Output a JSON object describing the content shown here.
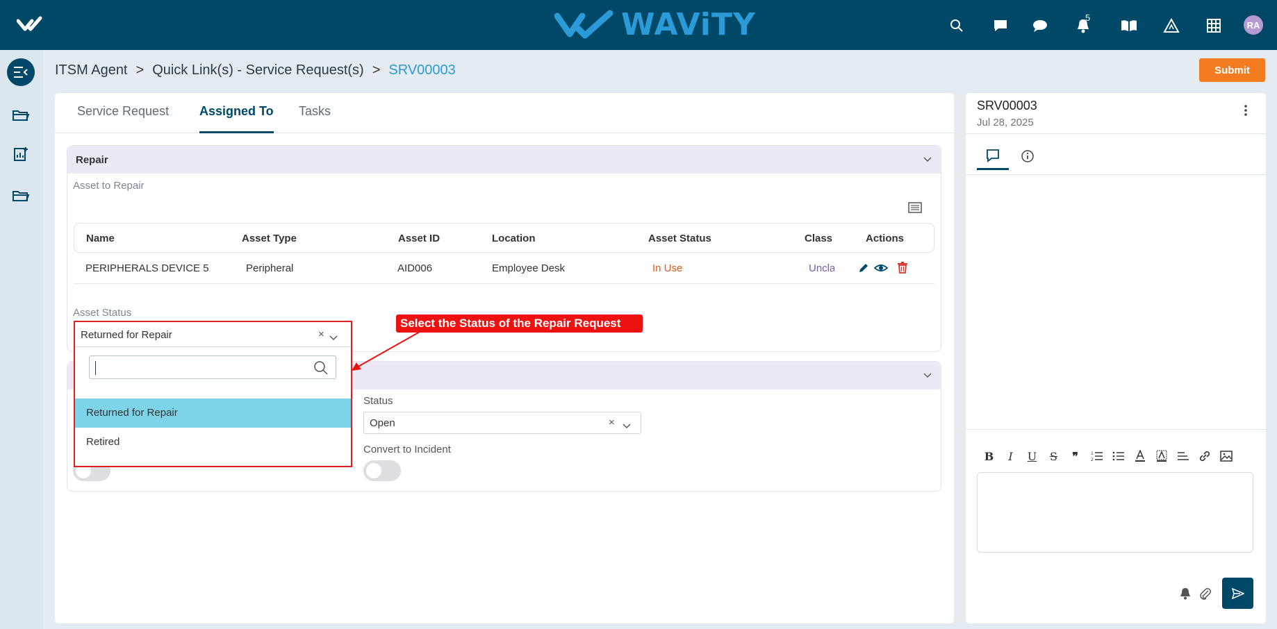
{
  "header": {
    "brand": "WAViTY",
    "notification_count": "5",
    "avatar_initials": "RA",
    "icons": [
      "search-icon",
      "message-square-icon",
      "chat-icon",
      "bell-icon",
      "book-icon",
      "warning-icon",
      "grid-icon"
    ]
  },
  "colors": {
    "header_bg": "#004868",
    "brand": "#2c9ad6",
    "submit": "#f47b20",
    "highlight": "#7dd4e8",
    "callout": "#ee1111",
    "status_in_use": "#e0591a"
  },
  "breadcrumb": {
    "item1": "ITSM Agent",
    "sep": ">",
    "item2": "Quick Link(s) - Service Request(s)",
    "current": "SRV00003"
  },
  "submit_label": "Submit",
  "tabs": [
    {
      "label": "Service Request"
    },
    {
      "label": "Assigned To"
    },
    {
      "label": "Tasks"
    }
  ],
  "repair": {
    "title": "Repair",
    "asset_to_repair_label": "Asset to Repair",
    "columns": [
      "Name",
      "Asset Type",
      "Asset ID",
      "Location",
      "Asset Status",
      "Class",
      "Actions"
    ],
    "rows": [
      {
        "name": "PERIPHERALS DEVICE 5",
        "type": "Peripheral",
        "id": "AID006",
        "location": "Employee Desk",
        "status": "In Use",
        "class": "Uncla"
      }
    ],
    "asset_status_label": "Asset Status",
    "asset_status_value": "Returned for Repair",
    "dropdown_options": [
      "Returned for Repair",
      "Retired"
    ]
  },
  "second_section": {
    "status_label": "Status",
    "status_value": "Open",
    "convert_label": "Convert to Incident"
  },
  "callout_text": "Select the Status of the Repair Request",
  "right_panel": {
    "title": "SRV00003",
    "date": "Jul 28, 2025"
  }
}
